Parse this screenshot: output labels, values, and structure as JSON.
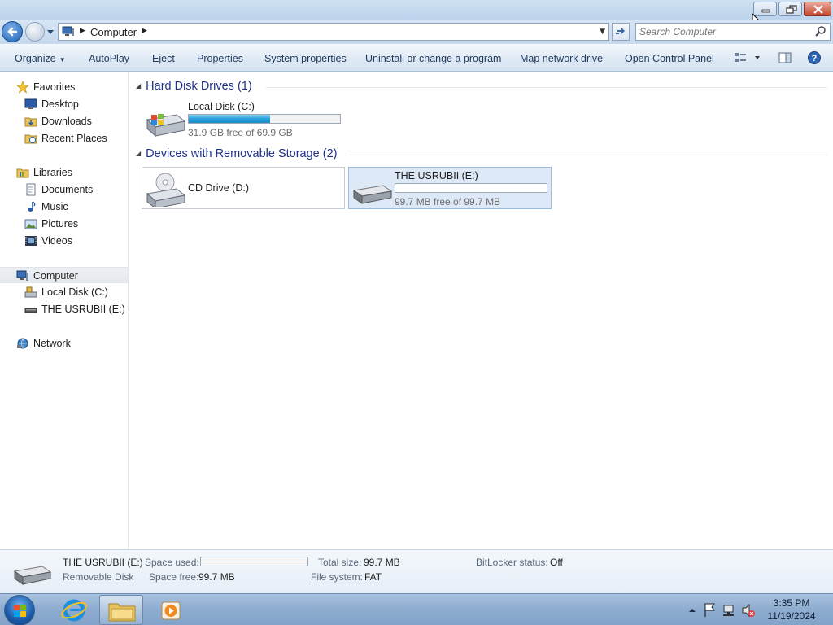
{
  "window": {
    "buttons": {
      "minimize": "minimize",
      "maximize": "restore",
      "close": "close"
    }
  },
  "address": {
    "crumb": "Computer",
    "search_placeholder": "Search Computer"
  },
  "toolbar": {
    "organize": "Organize",
    "autoplay": "AutoPlay",
    "eject": "Eject",
    "properties": "Properties",
    "system_properties": "System properties",
    "uninstall": "Uninstall or change a program",
    "map_drive": "Map network drive",
    "control_panel": "Open Control Panel"
  },
  "nav": {
    "favorites": "Favorites",
    "desktop": "Desktop",
    "downloads": "Downloads",
    "recent": "Recent Places",
    "libraries": "Libraries",
    "documents": "Documents",
    "music": "Music",
    "pictures": "Pictures",
    "videos": "Videos",
    "computer": "Computer",
    "local_disk": "Local Disk (C:)",
    "usb": "THE USRUBII (E:)",
    "network": "Network"
  },
  "groups": {
    "hdd": "Hard Disk Drives (1)",
    "removable": "Devices with Removable Storage (2)"
  },
  "drives": {
    "c": {
      "name": "Local Disk (C:)",
      "free": "31.9 GB free of 69.9 GB",
      "used_fraction": 0.54
    },
    "d": {
      "name": "CD Drive (D:)"
    },
    "e": {
      "name": "THE USRUBII (E:)",
      "free": "99.7 MB free of 99.7 MB",
      "used_fraction": 0.0
    }
  },
  "details": {
    "name": "THE USRUBII (E:)",
    "type": "Removable Disk",
    "space_used_label": "Space used:",
    "space_free_label": "Space free:",
    "space_free": "99.7 MB",
    "total_label": "Total size:",
    "total": "99.7 MB",
    "fs_label": "File system:",
    "fs": "FAT",
    "bitlocker_label": "BitLocker status:",
    "bitlocker": "Off"
  },
  "taskbar": {
    "time": "3:35 PM",
    "date": "11/19/2024"
  },
  "colors": {
    "accent": "#1e3287",
    "progress": "#26a0da",
    "selection": "#dde9f7"
  }
}
